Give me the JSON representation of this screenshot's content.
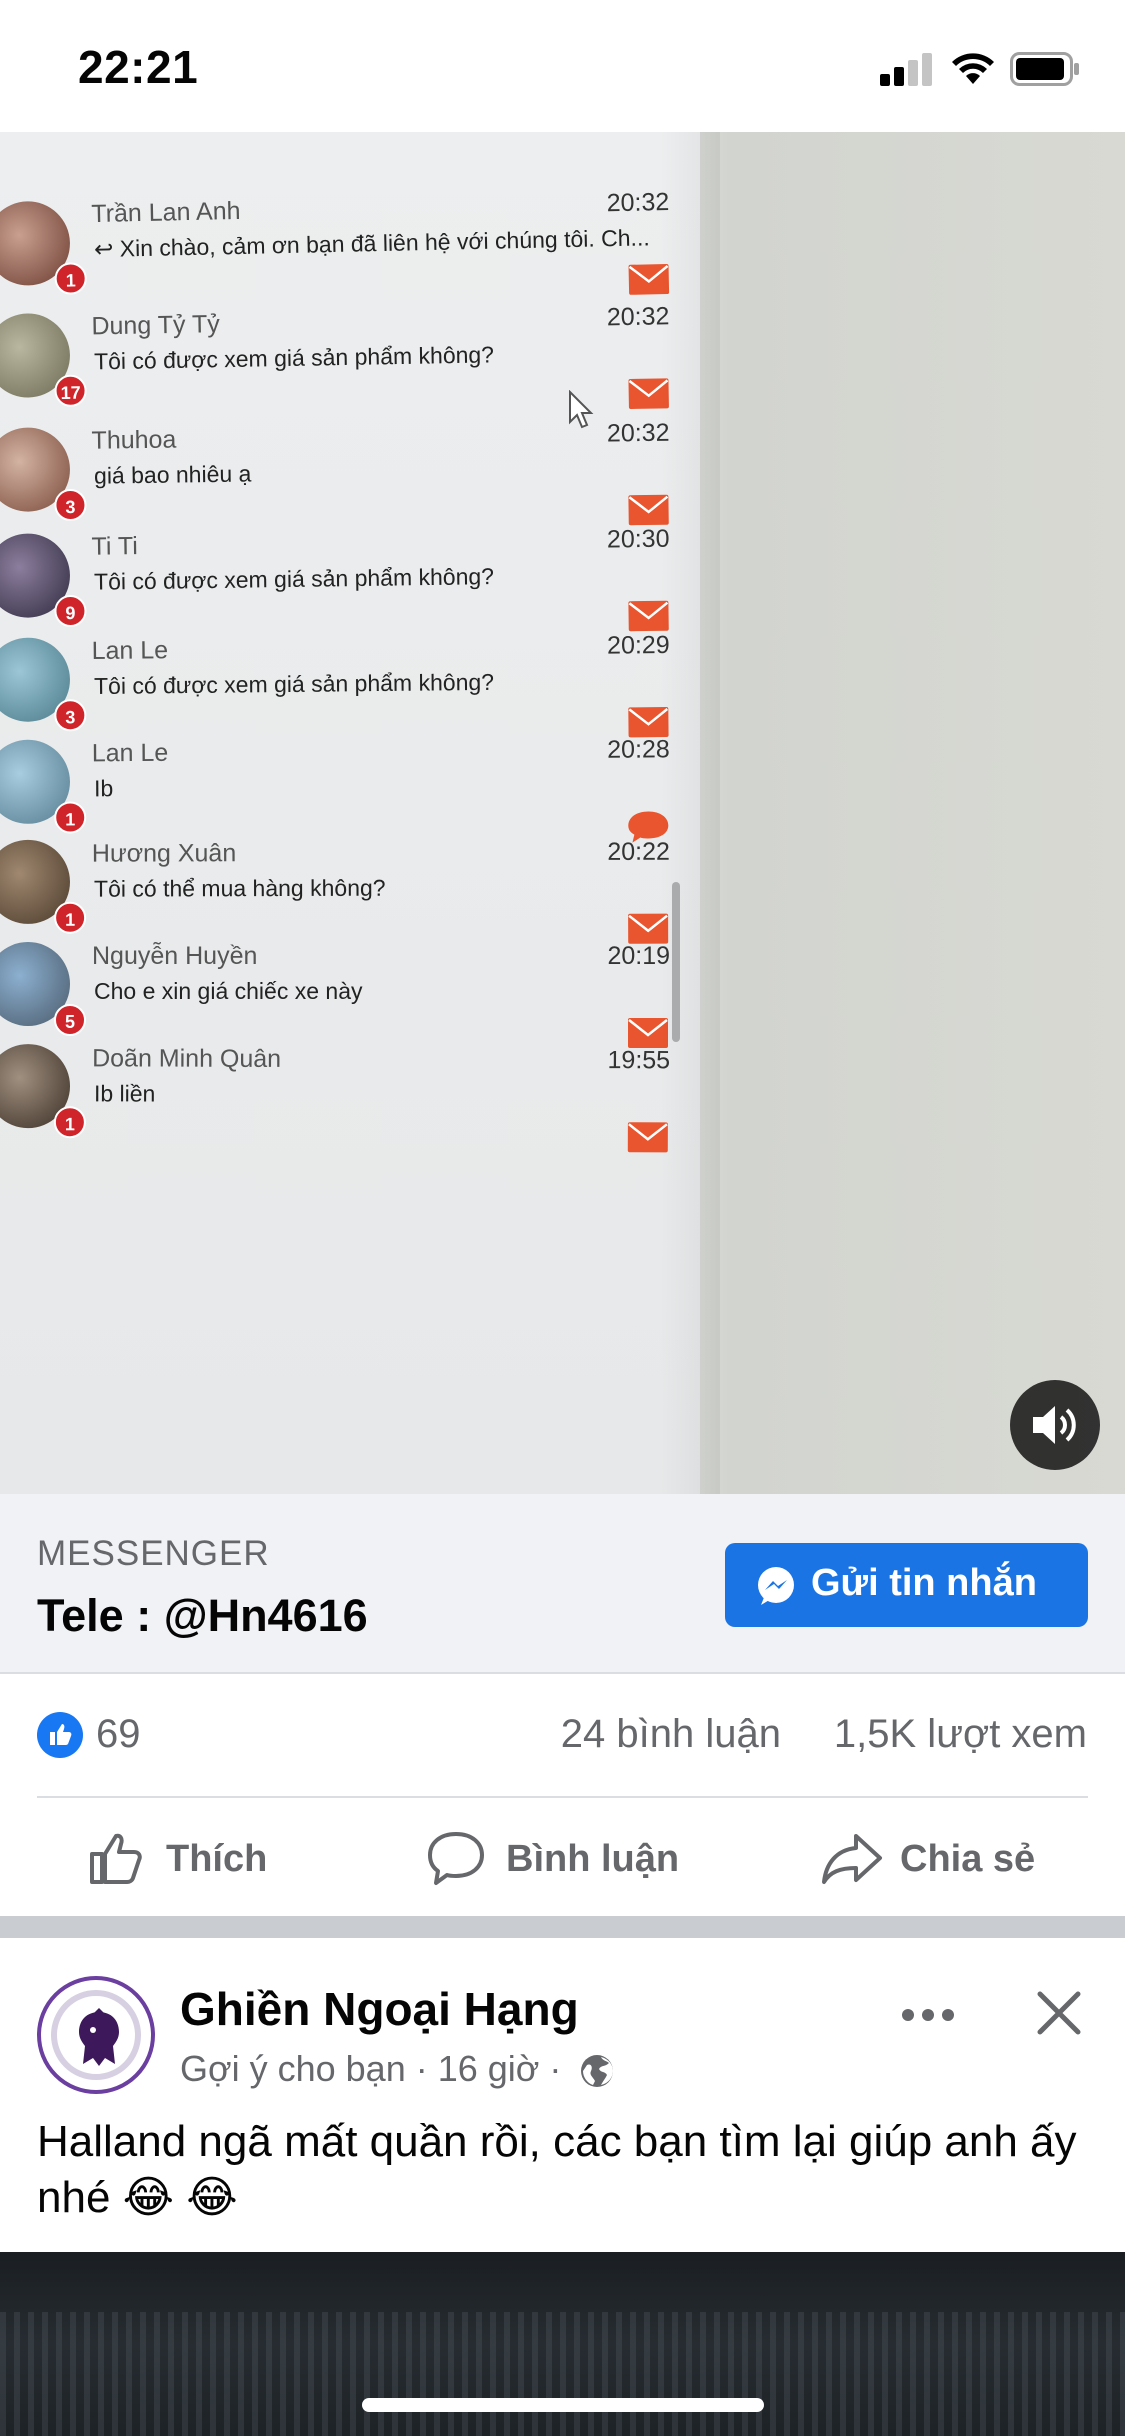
{
  "status_bar": {
    "time": "22:21"
  },
  "video": {
    "chats": [
      {
        "name": "Trần Lan Anh",
        "message": "↩ Xin chào, cảm ơn bạn đã liên hệ với chúng tôi. Ch...",
        "time": "20:32",
        "badge": "1",
        "icon": "envelope-icon"
      },
      {
        "name": "Dung Tỷ Tỷ",
        "message": "Tôi có được xem giá sản phẩm không?",
        "time": "20:32",
        "badge": "17",
        "icon": "envelope-icon"
      },
      {
        "name": "Thuhoa",
        "message": "giá bao nhiêu ạ",
        "time": "20:32",
        "badge": "3",
        "icon": "envelope-icon"
      },
      {
        "name": "Ti Ti",
        "message": "Tôi có được xem giá sản phẩm không?",
        "time": "20:30",
        "badge": "9",
        "icon": "envelope-icon"
      },
      {
        "name": "Lan Le",
        "message": "Tôi có được xem giá sản phẩm không?",
        "time": "20:29",
        "badge": "3",
        "icon": "envelope-icon"
      },
      {
        "name": "Lan Le",
        "message": "Ib",
        "time": "20:28",
        "badge": "1",
        "icon": "chat-bubble-icon"
      },
      {
        "name": "Hương Xuân",
        "message": "Tôi có thể mua hàng không?",
        "time": "20:22",
        "badge": "1",
        "icon": "envelope-icon"
      },
      {
        "name": "Nguyễn Huyền",
        "message": "Cho e xin giá chiếc xe này",
        "time": "20:19",
        "badge": "5",
        "icon": "envelope-icon"
      },
      {
        "name": "Doãn Minh Quân",
        "message": "Ib liền",
        "time": "19:55",
        "badge": "1",
        "icon": "envelope-icon"
      }
    ],
    "accent_color": "#e8552e"
  },
  "cta": {
    "label": "MESSENGER",
    "title": "Tele : @Hn4616",
    "button_label": "Gửi tin nhắn",
    "button_color": "#1b74e4"
  },
  "stats": {
    "likes": "69",
    "comments": "24 bình luận",
    "views": "1,5K lượt xem"
  },
  "actions": {
    "like": "Thích",
    "comment": "Bình luận",
    "share": "Chia sẻ"
  },
  "post": {
    "author": "Ghiền Ngoại Hạng",
    "meta": "Gợi ý cho bạn · 16 giờ ·",
    "text": "Halland ngã mất quần rồi, các bạn tìm lại giúp anh ấy nhé 😂 😂"
  }
}
